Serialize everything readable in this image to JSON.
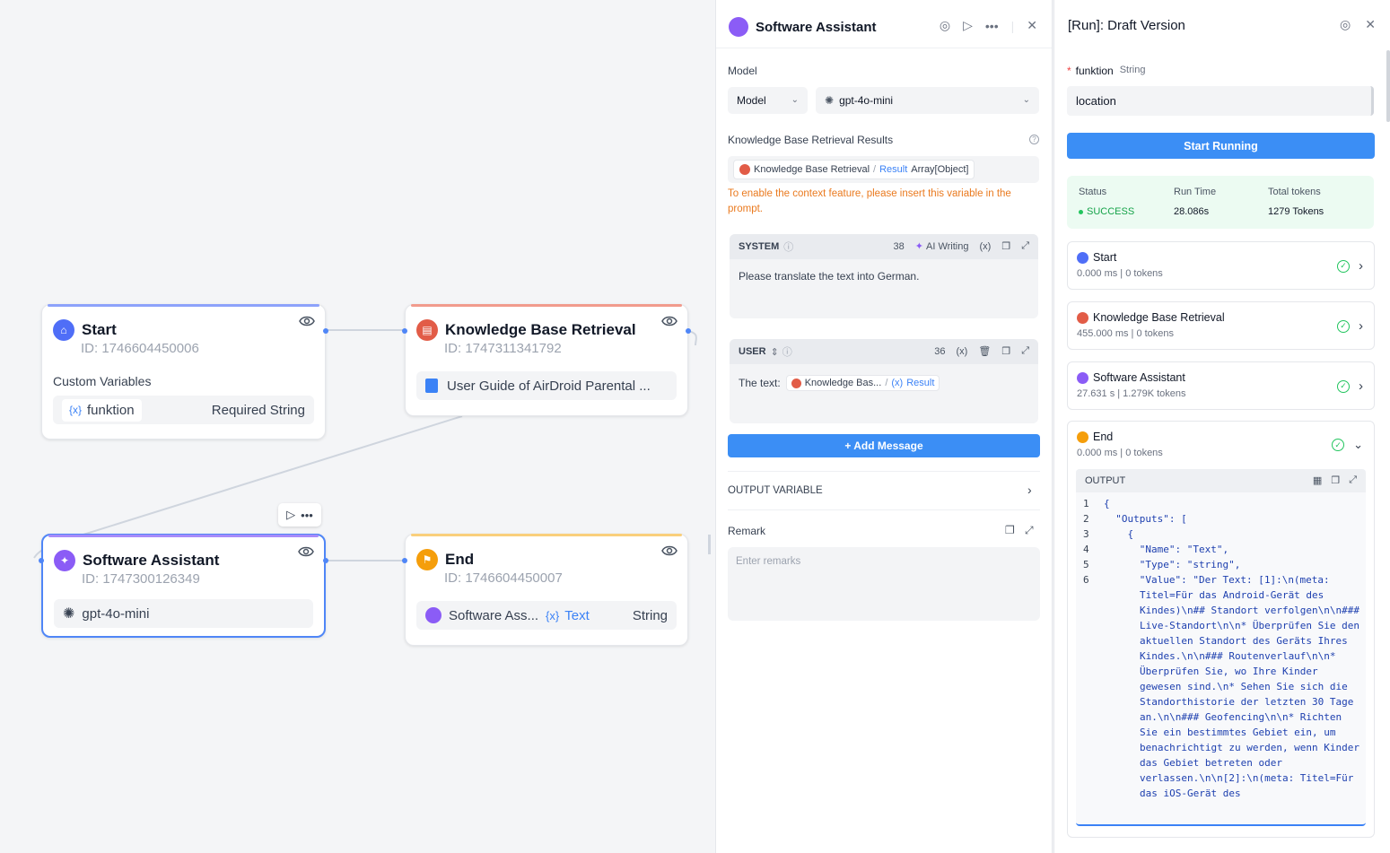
{
  "canvas": {
    "nodes": {
      "start": {
        "title": "Start",
        "id": "ID: 1746604450006",
        "section": "Custom Variables",
        "var_name": "funktion",
        "var_type": "Required String"
      },
      "kbr": {
        "title": "Knowledge Base Retrieval",
        "id": "ID: 1747311341792",
        "doc": "User Guide of AirDroid Parental ..."
      },
      "assistant": {
        "title": "Software Assistant",
        "id": "ID: 1747300126349",
        "model": "gpt-4o-mini"
      },
      "end": {
        "title": "End",
        "id": "ID: 1746604450007",
        "source": "Software Ass...",
        "var": "Text",
        "type": "String"
      }
    }
  },
  "mid_panel": {
    "title": "Software Assistant",
    "model_label": "Model",
    "model_mode": "Model",
    "model_name": "gpt-4o-mini",
    "kbr_label": "Knowledge Base Retrieval Results",
    "kbr_chip": {
      "node": "Knowledge Base Retrieval",
      "var": "Result",
      "type": "Array[Object]"
    },
    "warning": "To enable the context feature, please insert this variable in the prompt.",
    "system": {
      "label": "SYSTEM",
      "count": "38",
      "ai_writing": "AI Writing",
      "text": "Please translate the text into German."
    },
    "user": {
      "label": "USER",
      "count": "36",
      "prefix": "The text:",
      "chip_node": "Knowledge Bas...",
      "chip_var": "Result"
    },
    "add_message": "+ Add Message",
    "output_variable": "OUTPUT VARIABLE",
    "remark_label": "Remark",
    "remark_placeholder": "Enter remarks"
  },
  "right_panel": {
    "title": "[Run]: Draft Version",
    "field_label": "funktion",
    "field_type": "String",
    "field_value": "location",
    "start_button": "Start Running",
    "status": {
      "status_label": "Status",
      "status_value": "SUCCESS",
      "time_label": "Run Time",
      "time_value": "28.086s",
      "tokens_label": "Total tokens",
      "tokens_value": "1279 Tokens"
    },
    "traces": [
      {
        "title": "Start",
        "sub": "0.000 ms | 0 tokens"
      },
      {
        "title": "Knowledge Base Retrieval",
        "sub": "455.000 ms | 0 tokens"
      },
      {
        "title": "Software Assistant",
        "sub": "27.631 s | 1.279K tokens"
      },
      {
        "title": "End",
        "sub": "0.000 ms | 0 tokens"
      }
    ],
    "output_label": "OUTPUT",
    "code_lines": [
      {
        "n": "1",
        "t": "{"
      },
      {
        "n": "2",
        "t": "  \"Outputs\": ["
      },
      {
        "n": "3",
        "t": "    {"
      },
      {
        "n": "4",
        "t": "      \"Name\": \"Text\","
      },
      {
        "n": "5",
        "t": "      \"Type\": \"string\","
      },
      {
        "n": "6",
        "t": "      \"Value\": \"Der Text: [1]:\\n(meta: Titel=Für das Android-Gerät des Kindes)\\n## Standort verfolgen\\n\\n### Live-Standort\\n\\n* Überprüfen Sie den aktuellen Standort des Geräts Ihres Kindes.\\n\\n### Routenverlauf\\n\\n* Überprüfen Sie, wo Ihre Kinder gewesen sind.\\n* Sehen Sie sich die Standorthistorie der letzten 30 Tage an.\\n\\n### Geofencing\\n\\n* Richten Sie ein bestimmtes Gebiet ein, um benachrichtigt zu werden, wenn Kinder das Gebiet betreten oder verlassen.\\n\\n[2]:\\n(meta: Titel=Für das iOS-Gerät des"
      }
    ]
  },
  "colors": {
    "accent": "#3b8ef5",
    "success": "#22c55e",
    "warning": "#ea7a1f",
    "start": "#4f6ef7",
    "kbr": "#e25c47",
    "assistant": "#8b5cf6",
    "end": "#f59e0b"
  }
}
